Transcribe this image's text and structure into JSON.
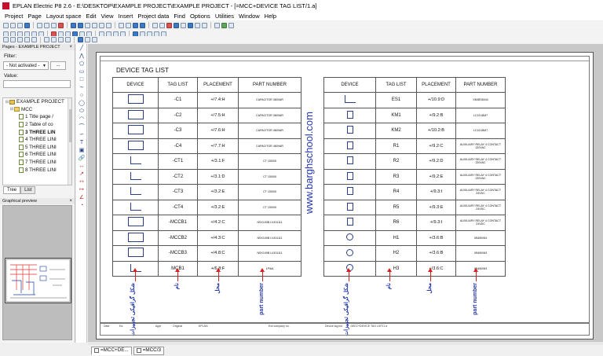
{
  "window": {
    "title": "EPLAN Electric P8 2.6 - E:\\DESKTOP\\EXAMPLE PROJECT\\EXAMPLE PROJECT - [=MCC+DEVICE TAG LIST/1.a]"
  },
  "menu": [
    "Project",
    "Page",
    "Layout space",
    "Edit",
    "View",
    "Insert",
    "Project data",
    "Find",
    "Options",
    "Utilities",
    "Window",
    "Help"
  ],
  "pages_panel": {
    "title": "Pages - EXAMPLE PROJECT",
    "close": "×",
    "filter_label": "Filter:",
    "filter_value": "- Not activated -",
    "filter_button": "...",
    "value_label": "Value:",
    "value_input": "",
    "tree": [
      {
        "label": "EXAMPLE PROJECT",
        "level": 0,
        "icon": "project-icon",
        "exp": "⊟"
      },
      {
        "label": "MCC",
        "level": 1,
        "icon": "folder-icon",
        "exp": "⊟"
      },
      {
        "label": "1 Title page /",
        "level": 2,
        "icon": "page-icon",
        "exp": ""
      },
      {
        "label": "2 Table of co",
        "level": 2,
        "icon": "page-icon",
        "exp": ""
      },
      {
        "label": "3 THREE LIN",
        "level": 2,
        "icon": "page-icon",
        "exp": "",
        "selected": true
      },
      {
        "label": "4 THREE LINI",
        "level": 2,
        "icon": "page-icon",
        "exp": ""
      },
      {
        "label": "5 THREE LINI",
        "level": 2,
        "icon": "page-icon",
        "exp": ""
      },
      {
        "label": "6 THREE LINI",
        "level": 2,
        "icon": "page-icon",
        "exp": ""
      },
      {
        "label": "7 THREE LINI",
        "level": 2,
        "icon": "page-icon",
        "exp": ""
      },
      {
        "label": "8 THREE LINI",
        "level": 2,
        "icon": "page-icon",
        "exp": ""
      }
    ],
    "tabs": [
      "Tree",
      "List"
    ]
  },
  "preview_panel": {
    "title": "Graphical preview"
  },
  "sheet": {
    "title": "DEVICE TAG LIST",
    "watermark": "www.barghschool.com",
    "headers": [
      "DEVICE",
      "TAG LIST",
      "PLACEMENT",
      "PART NUMBER"
    ],
    "left_rows": [
      {
        "tag": "-C1",
        "placement": "+/7.4:H",
        "part": "CAPACITOR 380VAR",
        "sym": "big"
      },
      {
        "tag": "-C2",
        "placement": "+/7.5:H",
        "part": "CAPACITOR 380VAR",
        "sym": "big"
      },
      {
        "tag": "-C3",
        "placement": "+/7.6:H",
        "part": "CAPACITOR 480VAR",
        "sym": "big"
      },
      {
        "tag": "-C4",
        "placement": "+/7.7:H",
        "part": "CAPACITOR 480VAR",
        "sym": "big"
      },
      {
        "tag": "-CT1",
        "placement": "+/3.1:F",
        "part": "CT 1500/5",
        "sym": "br"
      },
      {
        "tag": "-CT2",
        "placement": "+/3.1:D",
        "part": "CT 1500/5",
        "sym": "br"
      },
      {
        "tag": "-CT3",
        "placement": "+/3.2:E",
        "part": "CT 1500/5",
        "sym": "br"
      },
      {
        "tag": "-CT4",
        "placement": "+/3.2:E",
        "part": "CT 1500/5",
        "sym": "br"
      },
      {
        "tag": "-MCCB1",
        "placement": "+/4.2:C",
        "part": "NSX100B LV431111",
        "sym": "big"
      },
      {
        "tag": "-MCCB2",
        "placement": "+/4.3:C",
        "part": "NSX100B LV431111",
        "sym": "big"
      },
      {
        "tag": "-MCCB3",
        "placement": "+/4.8:C",
        "part": "NSX100B LV431111",
        "sym": "big"
      },
      {
        "tag": "MCB1",
        "placement": "+/6.8:F",
        "part": "1P/6A",
        "sym": "br"
      }
    ],
    "right_rows": [
      {
        "tag": "ES1",
        "placement": "+/10.9:D",
        "part": "XB4BS8444",
        "sym": "br"
      },
      {
        "tag": "KM1",
        "placement": "+/9.2:B",
        "part": "LC1D18M7",
        "sym": "coil"
      },
      {
        "tag": "KM2",
        "placement": "+/10.2:B",
        "part": "LC1D18M7",
        "sym": "coil"
      },
      {
        "tag": "R1",
        "placement": "+/9.2:C",
        "part": "AUXILIARY RELAY 4 CONTACT 220VAC",
        "sym": "coil"
      },
      {
        "tag": "R2",
        "placement": "+/9.2:D",
        "part": "AUXILIARY RELAY 4 CONTACT 220VAC",
        "sym": "coil"
      },
      {
        "tag": "R3",
        "placement": "+/9.2:E",
        "part": "AUXILIARY RELAY 4 CONTACT 220VAC",
        "sym": "coil"
      },
      {
        "tag": "R4",
        "placement": "+/9.3:I",
        "part": "AUXILIARY RELAY 4 CONTACT 24VDC",
        "sym": "coil"
      },
      {
        "tag": "R5",
        "placement": "+/9.3:E",
        "part": "AUXILIARY RELAY 4 CONTACT 24VDC",
        "sym": "coil"
      },
      {
        "tag": "R6",
        "placement": "+/9.3:I",
        "part": "AUXILIARY RELAY 4 CONTACT 24VDC",
        "sym": "coil"
      },
      {
        "tag": "H1",
        "placement": "+/3.6:B",
        "part": "XB4BVM4",
        "sym": "lamp"
      },
      {
        "tag": "H2",
        "placement": "+/3.6:B",
        "part": "XB4BVM3",
        "sym": "lamp"
      },
      {
        "tag": "H3",
        "placement": "+/3.6:C",
        "part": "XB4BVM3",
        "sym": "lamp"
      }
    ],
    "annotations": [
      "شکل گرافیکی تجهیزات",
      "نام",
      "محل",
      "part number"
    ],
    "titleblock": [
      "Date",
      "Ed.",
      "Appr",
      "Original",
      "EPLAN",
      "Exil company no.",
      "Device tag list",
      "=MCC+DEVICE TAG LIST/1.a"
    ]
  },
  "page_tabs": [
    {
      "label": "=MCC+DE...",
      "active": true
    },
    {
      "label": "=MCC/3",
      "active": false
    }
  ]
}
